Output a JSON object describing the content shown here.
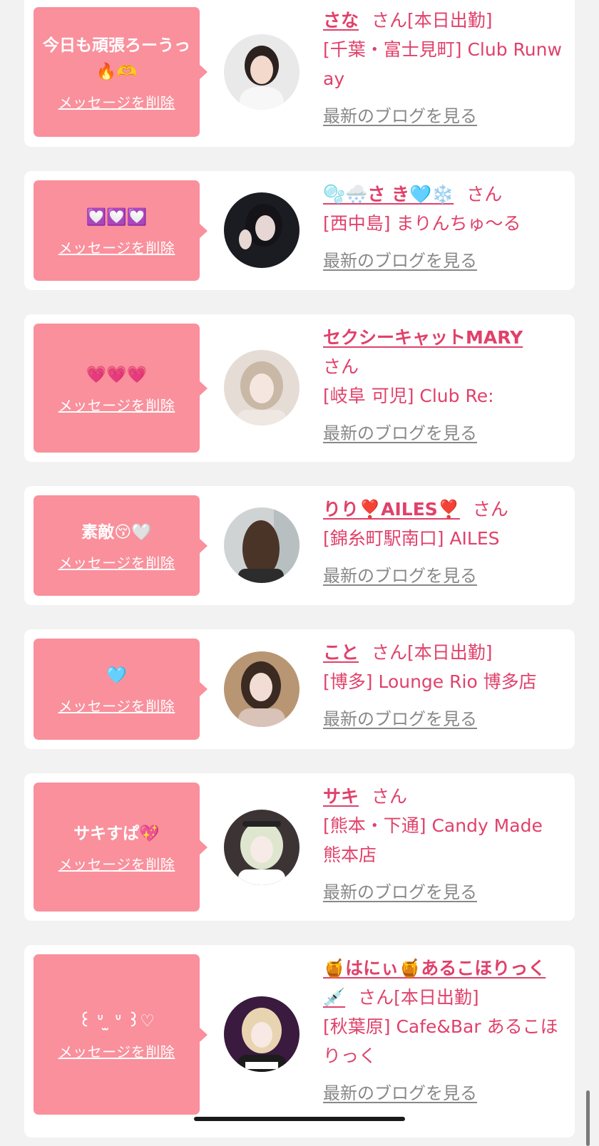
{
  "colors": {
    "page_background": "#f2f2f2",
    "card_background": "#ffffff",
    "bubble": "#f9909c",
    "accent_pink": "#e0416a",
    "link_gray": "#888888"
  },
  "delete_label": "メッセージを削除",
  "blog_label": "最新のブログを見る",
  "items": [
    {
      "message": "今日も頑張ろーうっ🔥🫶",
      "name": "さな",
      "san": "さん",
      "status": "[本日出勤]",
      "shop": "[千葉・富士見町] Club Runway",
      "avatar_icon": "girl-portrait-icon"
    },
    {
      "message": "💟💟💟",
      "name": "🫧🌨️さ き🩵❄️",
      "san": "さん",
      "status": "",
      "shop": "[西中島] まりんちゅ〜る",
      "avatar_icon": "girl-peace-sign-portrait-icon"
    },
    {
      "message": "💗💗💗",
      "name": "セクシーキャットMARY",
      "san": "さん",
      "status": "",
      "shop": "[岐阜 可児] Club Re:",
      "avatar_icon": "girl-portrait-icon"
    },
    {
      "message": "素敵😚🤍",
      "name": "りり❣️AILES❣️",
      "san": "さん",
      "status": "",
      "shop": "[錦糸町駅南口] AILES",
      "avatar_icon": "girl-back-view-portrait-icon"
    },
    {
      "message": "🩵",
      "name": "こと",
      "san": "さん",
      "status": "[本日出勤]",
      "shop": "[博多] Lounge Rio 博多店",
      "avatar_icon": "girl-portrait-icon"
    },
    {
      "message": "サキすぱ💖",
      "name": "サキ",
      "san": "さん",
      "status": "",
      "shop": "[熊本・下通] Candy Made 熊本店",
      "avatar_icon": "girl-maid-portrait-icon"
    },
    {
      "message": "꒰ ᐡ ̫ ᐡ ꒱♡",
      "name": "🍯はにぃ🍯あるこほりっく💉",
      "san": "さん",
      "status": "[本日出勤]",
      "shop": "[秋葉原] Cafe&Bar あるこほりっく",
      "avatar_icon": "girl-maid-portrait-icon"
    }
  ]
}
